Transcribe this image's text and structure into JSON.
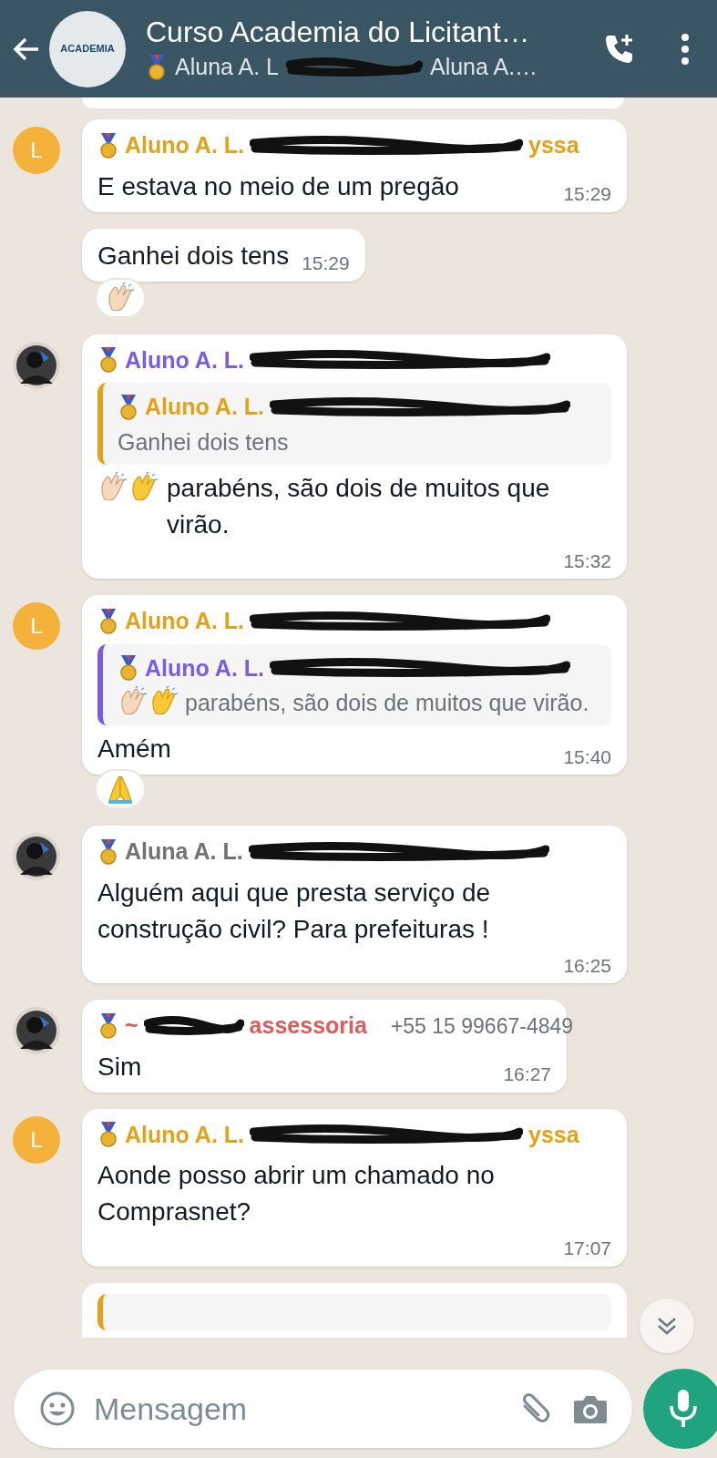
{
  "header": {
    "logo_text": "ACADEMIA",
    "title": "Curso Academia do Licitant…",
    "subtitle": {
      "first": "Aluna A. L",
      "redacted": true,
      "last": "Aluna A.…"
    }
  },
  "messages": [
    {
      "avatar": {
        "kind": "letter",
        "letter": "L"
      },
      "sender": {
        "name": "Aluno A. L.",
        "color": "#e3a21a",
        "redacted": true,
        "tail": "yssa"
      },
      "text": "E estava no meio de um pregão",
      "time": "15:29"
    },
    {
      "text": "Ganhei dois tens",
      "time": "15:29",
      "reaction": {
        "kind": "clap"
      }
    },
    {
      "sender": {
        "name": "Aluno A. L.",
        "color": "#7b5ce5",
        "redacted": true
      },
      "quote": {
        "name": "Aluno A. L.",
        "color": "#e3a21a",
        "redacted": true,
        "text": "Ganhei dois tens"
      },
      "clap_prefix": true,
      "text": "parabéns, são dois de muitos que virão.",
      "time": "15:32"
    },
    {
      "avatar": {
        "kind": "letter",
        "letter": "L"
      },
      "sender": {
        "name": "Aluno A. L.",
        "color": "#e3a21a",
        "redacted": true
      },
      "quote": {
        "name": "Aluno A. L.",
        "color": "#7b5ce5",
        "redacted": true,
        "clap_prefix": true,
        "text": "parabéns, são dois de muitos que virão."
      },
      "text": "Amém",
      "time": "15:40",
      "reaction": {
        "kind": "pray"
      }
    },
    {
      "sender": {
        "name": "Aluna A. L.",
        "color": "#737373",
        "redacted": true
      },
      "text": "Alguém aqui que presta serviço de construção civil? Para prefeituras !",
      "time": "16:25"
    },
    {
      "sender": {
        "name": "~",
        "color": "#e05a5a",
        "redacted": true,
        "tail": "assessoria",
        "phone": "+55 15 99667-4849"
      },
      "text": "Sim",
      "time": "16:27"
    },
    {
      "avatar": {
        "kind": "letter",
        "letter": "L"
      },
      "sender": {
        "name": "Aluno A. L.",
        "color": "#e3a21a",
        "redacted": true,
        "tail": "yssa"
      },
      "text": "Aonde posso abrir um chamado no Comprasnet?",
      "time": "17:07"
    }
  ],
  "cut_off_bubble": {
    "quote": {
      "color": "#e3a21a"
    }
  },
  "composer": {
    "placeholder": "Mensagem"
  }
}
